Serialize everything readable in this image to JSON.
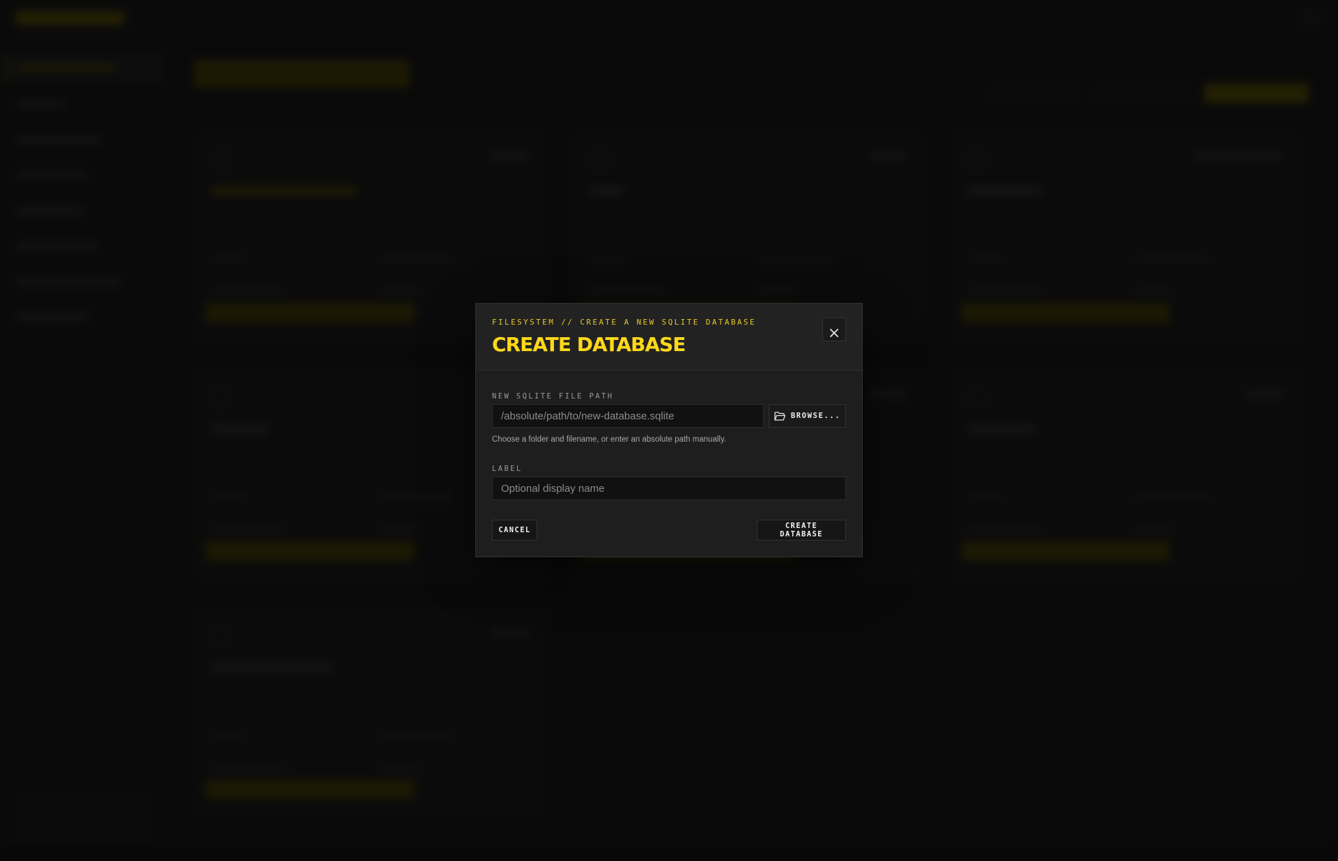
{
  "modal": {
    "eyebrow": "FILESYSTEM // CREATE A NEW SQLITE DATABASE",
    "title": "CREATE DATABASE",
    "close_icon": "close-icon",
    "path_field": {
      "label": "NEW SQLITE FILE PATH",
      "value": "",
      "placeholder": "/absolute/path/to/new-database.sqlite"
    },
    "browse_button": {
      "label": "BROWSE...",
      "icon": "folder-open-icon"
    },
    "hint": "Choose a folder and filename, or enter an absolute path manually.",
    "label_field": {
      "label": "LABEL",
      "value": "",
      "placeholder": "Optional display name"
    },
    "cancel_label": "CANCEL",
    "create_label": "CREATE DATABASE"
  },
  "colors": {
    "accent": "#ffd81a",
    "eyebrow": "#e8c92a",
    "modal_bg": "#1e1e1e",
    "input_bg": "#111111",
    "backdrop": "#141414"
  }
}
